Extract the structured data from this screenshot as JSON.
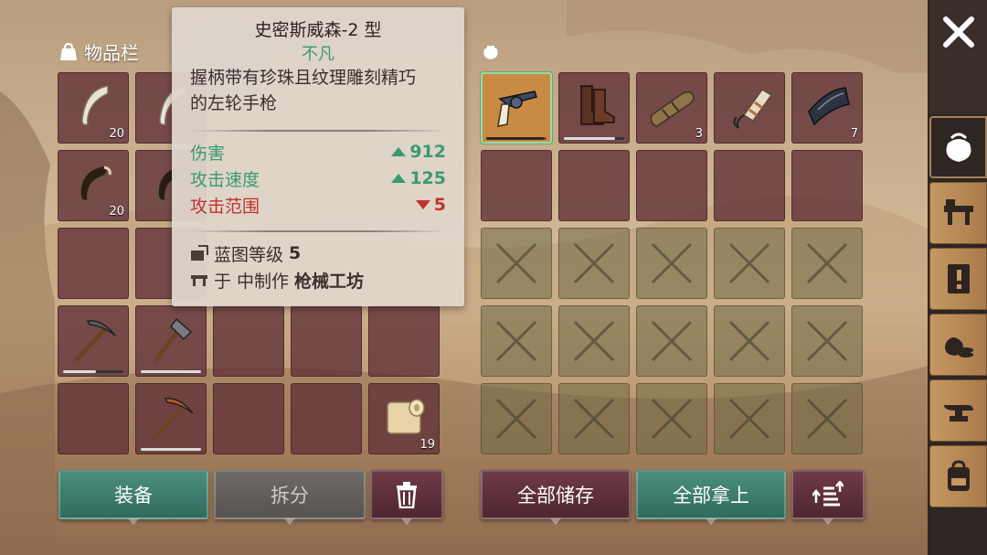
{
  "inventory": {
    "title": "物品栏",
    "slots": [
      {
        "icon": "fang-icon",
        "count": "20"
      },
      {
        "icon": "fang-icon",
        "count": ""
      },
      {
        "icon": "claw-icon",
        "count": "20"
      },
      {
        "icon": "claw-icon",
        "count": ""
      },
      {
        "icon": "pickaxe-icon",
        "durability": 0.9
      },
      {
        "icon": "axe-icon",
        "durability": 1.0
      },
      {
        "icon": "pickaxe-icon",
        "durability": 1.0
      },
      {
        "icon": "cloth-roll-icon",
        "count": "19"
      }
    ]
  },
  "storage": {
    "icon": "bag-icon",
    "slots": [
      {
        "icon": "revolver-icon",
        "selected": true
      },
      {
        "icon": "boots-icon",
        "durability": 0.85
      },
      {
        "icon": "bedroll-icon",
        "count": "3"
      },
      {
        "icon": "dynamite-icon",
        "count": ""
      },
      {
        "icon": "metal-plate-icon",
        "count": "7"
      }
    ]
  },
  "tooltip": {
    "name": "史密斯威森-2 型",
    "rarity": "不凡",
    "description_line1": "握柄带有珍珠且纹理雕刻精巧",
    "description_line2": "的左轮手枪",
    "stats": [
      {
        "label": "伤害",
        "value": "912",
        "trend": "up",
        "color": "#3c9a6f"
      },
      {
        "label": "攻击速度",
        "value": "125",
        "trend": "up",
        "color": "#3c9a6f"
      },
      {
        "label": "攻击范围",
        "value": "5",
        "trend": "down",
        "color": "#c0332f"
      }
    ],
    "blueprint_label": "蓝图等级",
    "blueprint_level": "5",
    "craft_prefix": "于 中制作",
    "craft_station": "枪械工坊"
  },
  "buttons": {
    "equip": "装备",
    "dismantle": "拆分",
    "store_all": "全部储存",
    "take_all": "全部拿上"
  },
  "sidebar": {
    "close": "✕",
    "tabs": [
      "bag-icon",
      "crafting-bench-icon",
      "quest-scroll-icon",
      "trade-icon",
      "anvil-icon",
      "backpack-icon"
    ]
  },
  "colors": {
    "positive": "#3c9a6f",
    "negative": "#c0332f",
    "slot": "#63343a",
    "button_green": "#3f7d6e"
  }
}
